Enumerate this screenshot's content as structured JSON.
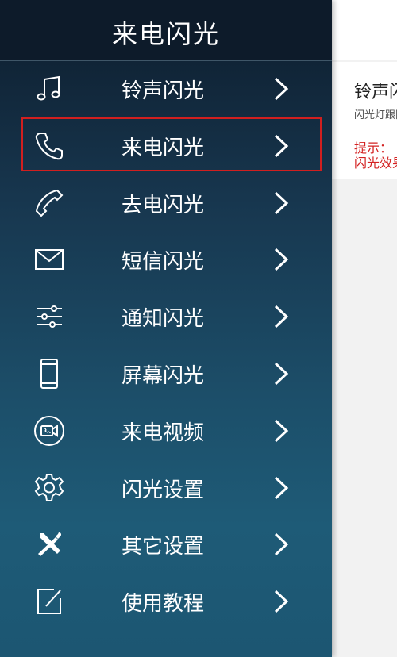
{
  "drawer": {
    "title": "来电闪光",
    "items": [
      {
        "label": "铃声闪光",
        "icon": "music-note-icon"
      },
      {
        "label": "来电闪光",
        "icon": "phone-icon"
      },
      {
        "label": "去电闪光",
        "icon": "outgoing-phone-icon"
      },
      {
        "label": "短信闪光",
        "icon": "envelope-icon"
      },
      {
        "label": "通知闪光",
        "icon": "sliders-icon"
      },
      {
        "label": "屏幕闪光",
        "icon": "smartphone-icon"
      },
      {
        "label": "来电视频",
        "icon": "video-call-icon"
      },
      {
        "label": "闪光设置",
        "icon": "gear-icon"
      },
      {
        "label": "其它设置",
        "icon": "tools-icon"
      },
      {
        "label": "使用教程",
        "icon": "edit-icon"
      }
    ],
    "selected_index": 1
  },
  "content": {
    "card_title": "铃声闪光",
    "card_subtitle": "闪光灯跟随铃声节奏闪烁",
    "tip_line1": "提示：",
    "tip_line2": "闪光效果"
  },
  "colors": {
    "accent": "#13a8a8",
    "selection": "#d11f1f",
    "tip": "#d32222"
  }
}
